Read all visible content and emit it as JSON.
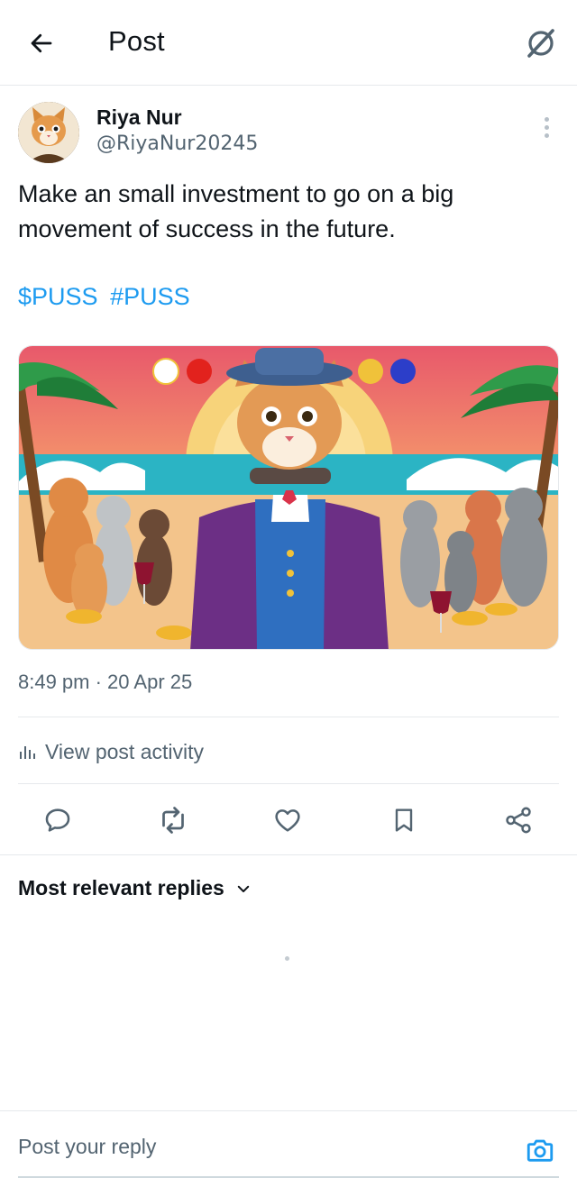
{
  "header": {
    "title": "Post"
  },
  "author": {
    "display_name": "Riya Nur",
    "handle": "@RiyaNur20245"
  },
  "post": {
    "text": "Make an small investment to go on a big movement of success in the future.",
    "tags": [
      "$PUSS",
      "#PUSS"
    ],
    "timestamp": "8:49 pm · 20 Apr 25"
  },
  "activity_label": "View post activity",
  "replies": {
    "sort_label": "Most relevant replies"
  },
  "reply_box": {
    "placeholder": "Post your reply"
  },
  "colors": {
    "accent": "#1d9bf0",
    "text": "#0f1419",
    "muted": "#536471",
    "border": "#e6e9ec"
  },
  "icons": {
    "back": "arrow-left-icon",
    "grok": "grok-icon",
    "more": "more-vertical-icon",
    "reply": "comment-icon",
    "repost": "repost-icon",
    "like": "heart-icon",
    "bookmark": "bookmark-icon",
    "share": "share-icon",
    "camera": "camera-icon",
    "analytics": "bar-chart-icon",
    "chevron": "chevron-down-icon"
  }
}
